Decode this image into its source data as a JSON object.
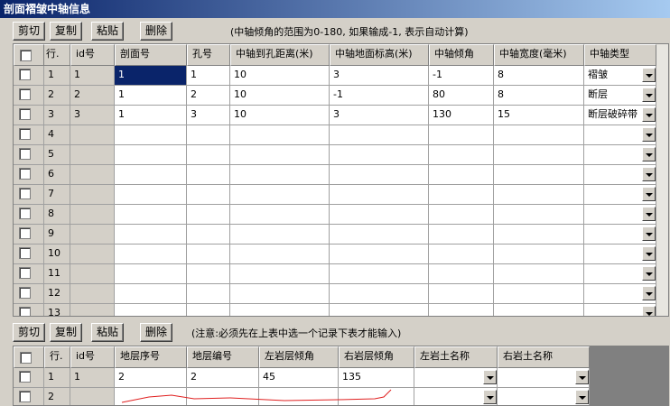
{
  "window": {
    "title": "剖面褶皱中轴信息"
  },
  "toolbar1": {
    "cut": "剪切",
    "copy": "复制",
    "paste": "粘贴",
    "delete": "删除",
    "hint": "(中轴倾角的范围为0-180, 如果输成-1, 表示自动计算)"
  },
  "toolbar2": {
    "cut": "剪切",
    "copy": "复制",
    "paste": "粘贴",
    "delete": "删除",
    "hint": "(注意:必须先在上表中选一个记录下表才能输入)"
  },
  "grid1": {
    "headers": [
      "行.",
      "id号",
      "剖面号",
      "孔号",
      "中轴到孔距离(米)",
      "中轴地面标高(米)",
      "中轴倾角",
      "中轴宽度(毫米)",
      "中轴类型"
    ],
    "rows": [
      {
        "row": "1",
        "id": "1",
        "section": "1",
        "hole": "1",
        "distance": "10",
        "elevation": "3",
        "dip": "-1",
        "width": "8",
        "type": "褶皱"
      },
      {
        "row": "2",
        "id": "2",
        "section": "1",
        "hole": "2",
        "distance": "10",
        "elevation": "-1",
        "dip": "80",
        "width": "8",
        "type": "断层"
      },
      {
        "row": "3",
        "id": "3",
        "section": "1",
        "hole": "3",
        "distance": "10",
        "elevation": "3",
        "dip": "130",
        "width": "15",
        "type": "断层破碎带"
      },
      {
        "row": "4"
      },
      {
        "row": "5"
      },
      {
        "row": "6"
      },
      {
        "row": "7"
      },
      {
        "row": "8"
      },
      {
        "row": "9"
      },
      {
        "row": "10"
      },
      {
        "row": "11"
      },
      {
        "row": "12"
      },
      {
        "row": "13"
      }
    ]
  },
  "grid2": {
    "headers": [
      "行.",
      "id号",
      "地层序号",
      "地层编号",
      "左岩层倾角",
      "右岩层倾角",
      "左岩土名称",
      "右岩土名称"
    ],
    "rows": [
      {
        "row": "1",
        "id": "1",
        "seq": "2",
        "code": "2",
        "left_dip": "45",
        "right_dip": "135",
        "left_name": "",
        "right_name": ""
      },
      {
        "row": "2"
      }
    ]
  }
}
